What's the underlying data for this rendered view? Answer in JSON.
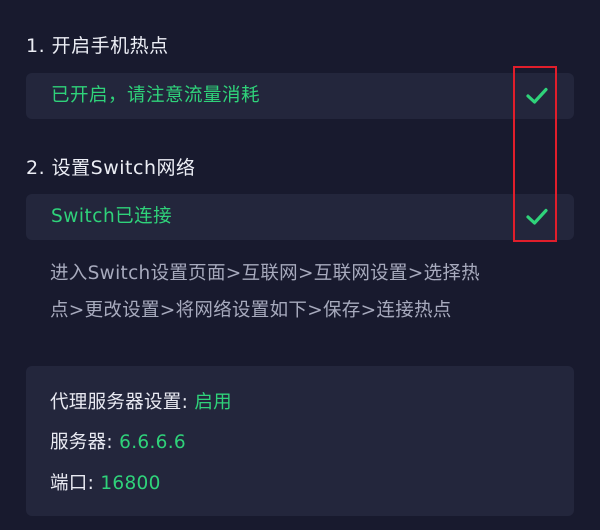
{
  "steps": [
    {
      "title": "1. 开启手机热点",
      "status": "已开启，请注意流量消耗",
      "check_icon": "check-icon"
    },
    {
      "title": "2. 设置Switch网络",
      "status": "Switch已连接",
      "check_icon": "check-icon"
    }
  ],
  "instructions": {
    "line1": "进入Switch设置页面>互联网>互联网设置>选择热",
    "line2": "点>更改设置>将网络设置如下>保存>连接热点"
  },
  "proxy": {
    "proxy_label": "代理服务器设置: ",
    "proxy_value": "启用",
    "server_label": "服务器: ",
    "server_value": "6.6.6.6",
    "port_label": "端口: ",
    "port_value": "16800"
  },
  "colors": {
    "background": "#181a2e",
    "card": "#23263c",
    "accent_green": "#2fd27a",
    "highlight_red": "#e01e2b"
  }
}
